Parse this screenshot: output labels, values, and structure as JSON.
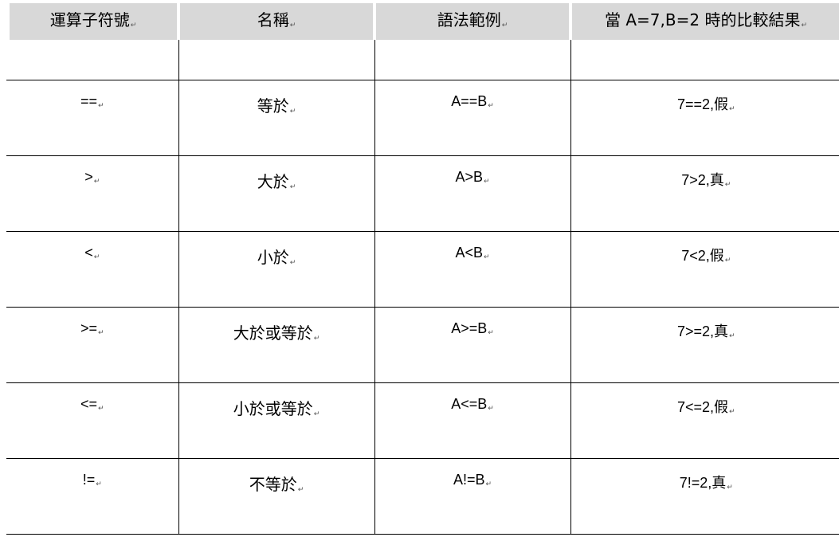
{
  "table": {
    "headers": [
      {
        "text": "運算子符號",
        "mark": "↵"
      },
      {
        "text": "名稱",
        "mark": "↵"
      },
      {
        "text": "語法範例",
        "mark": "↵"
      },
      {
        "text": "當 A=7,B=2 時的比較結果",
        "mark": "↵"
      }
    ],
    "rows": [
      {
        "operator": "==",
        "name": "等於",
        "syntax": "A==B",
        "result": "7==2,假",
        "mark": "↵"
      },
      {
        "operator": ">",
        "name": "大於",
        "syntax": "A>B",
        "result": "7>2,真",
        "mark": "↵"
      },
      {
        "operator": "<",
        "name": "小於",
        "syntax": "A<B",
        "result": "7<2,假",
        "mark": "↵"
      },
      {
        "operator": ">=",
        "name": "大於或等於",
        "syntax": "A>=B",
        "result": "7>=2,真",
        "mark": "↵"
      },
      {
        "operator": "<=",
        "name": "小於或等於",
        "syntax": "A<=B",
        "result": "7<=2,假",
        "mark": "↵"
      },
      {
        "operator": "!=",
        "name": "不等於",
        "syntax": "A!=B",
        "result": "7!=2,真",
        "mark": "↵"
      }
    ]
  },
  "colors": {
    "header_bg": "#d8d8d8",
    "border": "#000000"
  }
}
